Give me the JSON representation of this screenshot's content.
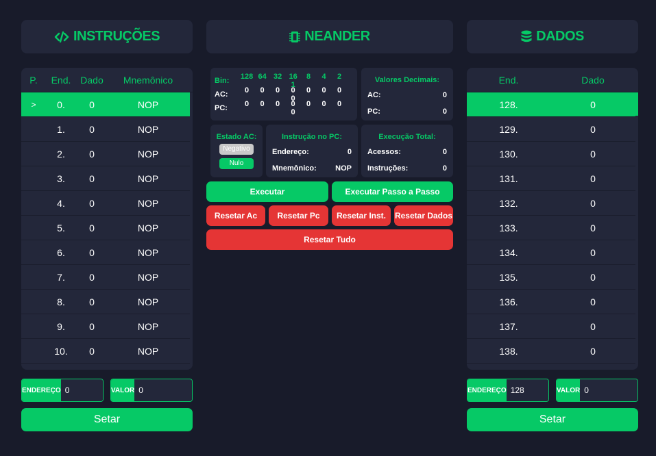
{
  "colors": {
    "accent": "#06c966",
    "danger": "#e53535",
    "panel": "#23273a",
    "background": "#181b2a"
  },
  "instrucoes": {
    "title": "INSTRUÇÕES",
    "icon": "code-icon",
    "columns": [
      "P.",
      "End.",
      "Dado",
      "Mnemônico"
    ],
    "pointer": ">",
    "rows": [
      {
        "end": "0.",
        "dado": "0",
        "mnem": "NOP"
      },
      {
        "end": "1.",
        "dado": "0",
        "mnem": "NOP"
      },
      {
        "end": "2.",
        "dado": "0",
        "mnem": "NOP"
      },
      {
        "end": "3.",
        "dado": "0",
        "mnem": "NOP"
      },
      {
        "end": "4.",
        "dado": "0",
        "mnem": "NOP"
      },
      {
        "end": "5.",
        "dado": "0",
        "mnem": "NOP"
      },
      {
        "end": "6.",
        "dado": "0",
        "mnem": "NOP"
      },
      {
        "end": "7.",
        "dado": "0",
        "mnem": "NOP"
      },
      {
        "end": "8.",
        "dado": "0",
        "mnem": "NOP"
      },
      {
        "end": "9.",
        "dado": "0",
        "mnem": "NOP"
      },
      {
        "end": "10.",
        "dado": "0",
        "mnem": "NOP"
      }
    ],
    "endereco_label": "ENDEREÇO",
    "endereco_value": "0",
    "valor_label": "VALOR",
    "valor_value": "0",
    "setar_label": "Setar"
  },
  "neander": {
    "title": "NEANDER",
    "icon": "chip-icon",
    "bin": {
      "label": "Bin:",
      "bits": [
        "128",
        "64",
        "32",
        "16",
        "8",
        "4",
        "2",
        "1"
      ],
      "ac_label": "AC:",
      "ac": [
        "0",
        "0",
        "0",
        "0",
        "0",
        "0",
        "0",
        "0"
      ],
      "pc_label": "PC:",
      "pc": [
        "0",
        "0",
        "0",
        "0",
        "0",
        "0",
        "0",
        "0"
      ]
    },
    "decimais": {
      "title": "Valores Decimais:",
      "ac_label": "AC:",
      "ac": "0",
      "pc_label": "PC:",
      "pc": "0"
    },
    "estado_ac": {
      "title": "Estado AC:",
      "negativo": "Negativo",
      "nulo": "Nulo"
    },
    "instrucao_pc": {
      "title": "Instrução no PC:",
      "endereco_label": "Endereço:",
      "endereco": "0",
      "mnemonico_label": "Mnemônico:",
      "mnemonico": "NOP"
    },
    "execucao": {
      "title": "Execução Total:",
      "acessos_label": "Acessos:",
      "acessos": "0",
      "instrucoes_label": "Instruções:",
      "instrucoes": "0"
    },
    "buttons": {
      "executar": "Executar",
      "passo": "Executar Passo a Passo",
      "reset_ac": "Resetar Ac",
      "reset_pc": "Resetar Pc",
      "reset_inst": "Resetar Inst.",
      "reset_dados": "Resetar Dados",
      "reset_tudo": "Resetar Tudo"
    }
  },
  "dados": {
    "title": "DADOS",
    "icon": "database-icon",
    "columns": [
      "End.",
      "Dado"
    ],
    "rows": [
      {
        "end": "128.",
        "dado": "0"
      },
      {
        "end": "129.",
        "dado": "0"
      },
      {
        "end": "130.",
        "dado": "0"
      },
      {
        "end": "131.",
        "dado": "0"
      },
      {
        "end": "132.",
        "dado": "0"
      },
      {
        "end": "133.",
        "dado": "0"
      },
      {
        "end": "134.",
        "dado": "0"
      },
      {
        "end": "135.",
        "dado": "0"
      },
      {
        "end": "136.",
        "dado": "0"
      },
      {
        "end": "137.",
        "dado": "0"
      },
      {
        "end": "138.",
        "dado": "0"
      }
    ],
    "endereco_label": "ENDEREÇO",
    "endereco_value": "128",
    "valor_label": "VALOR",
    "valor_value": "0",
    "setar_label": "Setar"
  }
}
